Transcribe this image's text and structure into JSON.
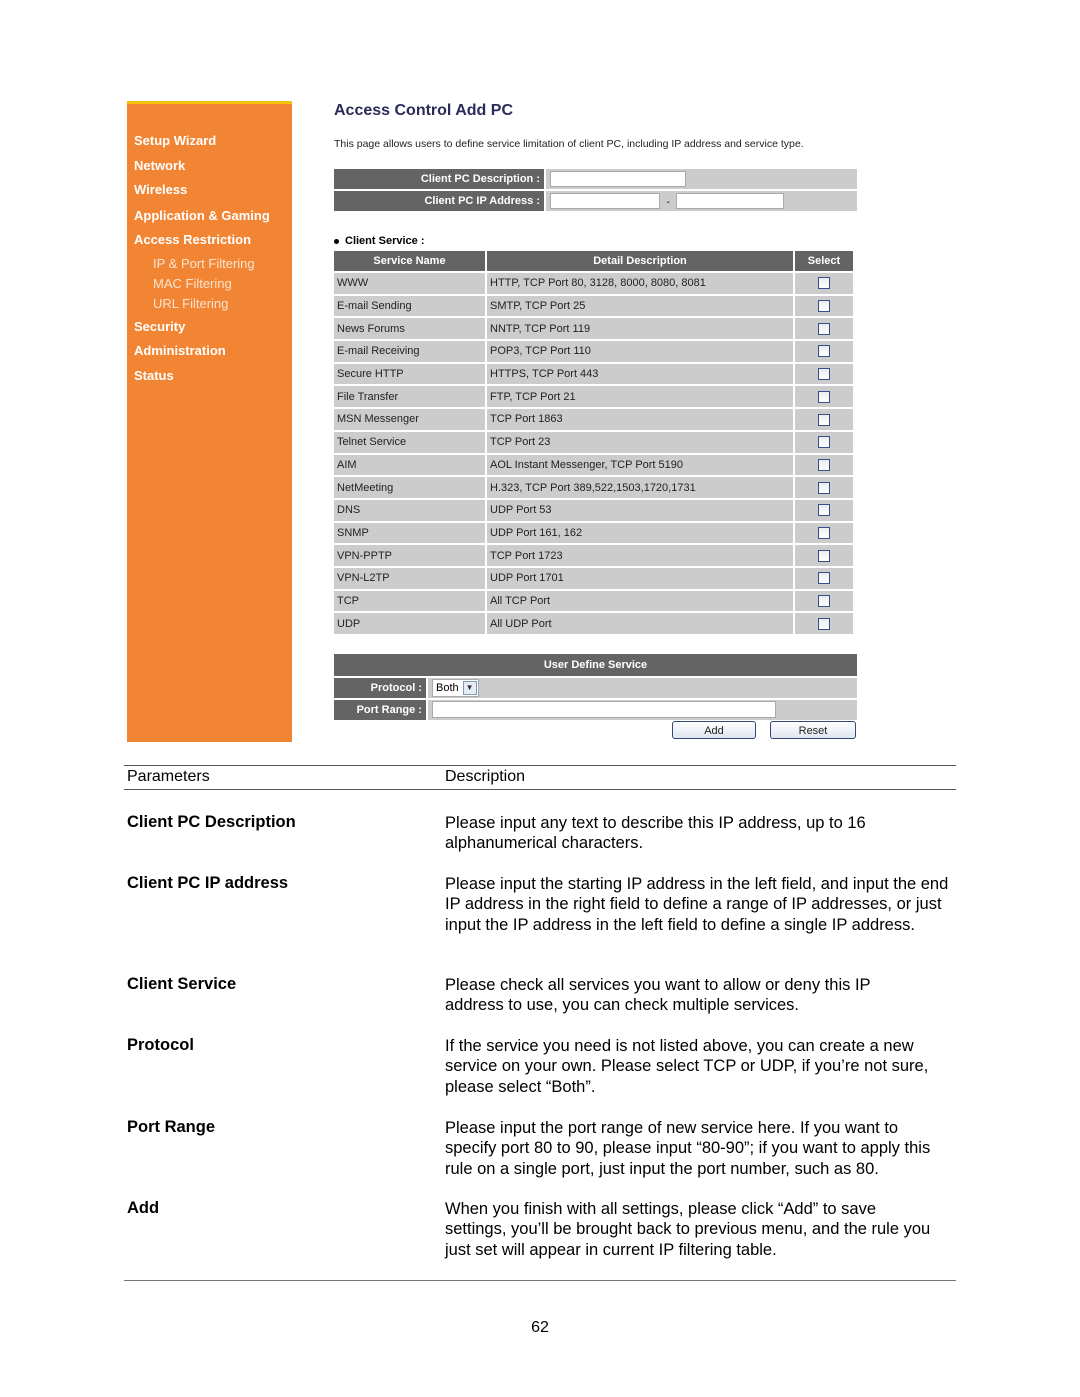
{
  "sidebar": {
    "items": [
      {
        "label": "Setup Wizard"
      },
      {
        "label": "Network"
      },
      {
        "label": "Wireless"
      },
      {
        "label": "Application & Gaming"
      },
      {
        "label": "Access Restriction"
      },
      {
        "label": "Security"
      },
      {
        "label": "Administration"
      },
      {
        "label": "Status"
      }
    ],
    "subitems": [
      {
        "label": "IP & Port Filtering"
      },
      {
        "label": "MAC Filtering"
      },
      {
        "label": "URL Filtering"
      }
    ],
    "colors": {
      "background": "#f28533",
      "top_border": "#f5c200"
    }
  },
  "router_page": {
    "title": "Access Control Add PC",
    "intro": "This page allows users to define service limitation of client PC, including IP address and service type.",
    "client_pc_description_label": "Client PC Description :",
    "client_pc_description_value": "",
    "client_pc_ip_label": "Client PC IP Address :",
    "client_pc_ip_start_value": "",
    "client_pc_ip_end_value": "",
    "ip_range_separator": "-",
    "client_service_label": "Client Service :",
    "service_table": {
      "headers": [
        "Service Name",
        "Detail Description",
        "Select"
      ],
      "rows": [
        {
          "name": "WWW",
          "detail": "HTTP, TCP Port 80, 3128, 8000, 8080, 8081",
          "checked": false
        },
        {
          "name": "E-mail Sending",
          "detail": "SMTP, TCP Port 25",
          "checked": false
        },
        {
          "name": "News Forums",
          "detail": "NNTP, TCP Port 119",
          "checked": false
        },
        {
          "name": "E-mail Receiving",
          "detail": "POP3, TCP Port 110",
          "checked": false
        },
        {
          "name": "Secure HTTP",
          "detail": "HTTPS, TCP Port 443",
          "checked": false
        },
        {
          "name": "File Transfer",
          "detail": "FTP, TCP Port 21",
          "checked": false
        },
        {
          "name": "MSN Messenger",
          "detail": "TCP Port 1863",
          "checked": false
        },
        {
          "name": "Telnet Service",
          "detail": "TCP Port 23",
          "checked": false
        },
        {
          "name": "AIM",
          "detail": "AOL Instant Messenger, TCP Port 5190",
          "checked": false
        },
        {
          "name": "NetMeeting",
          "detail": "H.323, TCP Port 389,522,1503,1720,1731",
          "checked": false
        },
        {
          "name": "DNS",
          "detail": "UDP Port 53",
          "checked": false
        },
        {
          "name": "SNMP",
          "detail": "UDP Port 161, 162",
          "checked": false
        },
        {
          "name": "VPN-PPTP",
          "detail": "TCP Port 1723",
          "checked": false
        },
        {
          "name": "VPN-L2TP",
          "detail": "UDP Port 1701",
          "checked": false
        },
        {
          "name": "TCP",
          "detail": "All TCP Port",
          "checked": false
        },
        {
          "name": "UDP",
          "detail": "All UDP Port",
          "checked": false
        }
      ]
    },
    "user_define_service": {
      "title": "User Define Service",
      "protocol_label": "Protocol :",
      "protocol_value": "Both",
      "port_range_label": "Port Range :",
      "port_range_value": ""
    },
    "buttons": {
      "add": "Add",
      "reset": "Reset"
    },
    "colors": {
      "header_bg": "#646464",
      "cell_bg": "#cccccc",
      "title": "#2b2b5a"
    }
  },
  "doc": {
    "headers": {
      "parameters": "Parameters",
      "description": "Description"
    },
    "rows": [
      {
        "param": "Client PC Description",
        "desc": "Please input any text to describe this IP address, up to 16 alphanumerical characters."
      },
      {
        "param": "Client PC IP address",
        "desc": "Please input the starting IP address in the left field, and input the end IP address in the right field to define a range of IP addresses, or just input the IP address in the left field to define a single IP address."
      },
      {
        "param": "Client Service",
        "desc": "Please check all services you want to allow or deny this IP address to use, you can check multiple services."
      },
      {
        "param": "Protocol",
        "desc": "If the service you need is not listed above, you can create a new service on your own. Please select TCP or UDP, if you’re not sure, please select “Both”."
      },
      {
        "param": "Port Range",
        "desc": "Please input the port range of new service here. If you want to specify port 80 to 90, please input “80-90”; if you want to apply this rule on a single port, just input the port number, such as 80."
      },
      {
        "param": "Add",
        "desc": "When you finish with all settings, please click “Add” to save settings, you’ll be brought back to previous menu, and the rule you just set will appear in current IP filtering table."
      }
    ],
    "page_number": "62"
  }
}
